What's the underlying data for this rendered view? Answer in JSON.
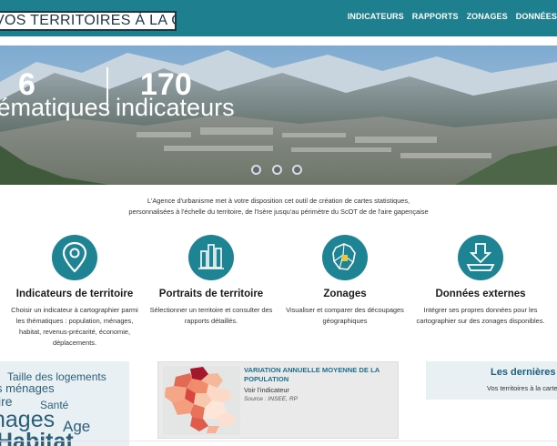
{
  "header": {
    "logo_text": "VOS TERRITOIRES À LA CARTE",
    "nav": [
      "INDICATEURS",
      "RAPPORTS",
      "ZONAGES",
      "DONNÉES"
    ]
  },
  "hero": {
    "stat1_value": "6",
    "stat1_label": "thématiques",
    "stat2_value": "170",
    "stat2_label": "indicateurs",
    "slides": 3
  },
  "intro": {
    "line1": "L'Agence d'urbanisme met à votre disposition cet outil de création de cartes statistiques,",
    "line2": "personnalisées à l'échelle du territoire, de l'Isère jusqu'au périmètre du ScOT de de l'aire gapençaise"
  },
  "features": [
    {
      "title": "Indicateurs de territoire",
      "desc": "Choisir un indicateur à cartographier parmi les thématiques : population, ménages, habitat, revenus-précarité, économie, déplacements.",
      "icon": "map-pin-icon"
    },
    {
      "title": "Portraits de territoire",
      "desc": "Sélectionner un territoire et consulter des rapports détaillés.",
      "icon": "bar-chart-icon"
    },
    {
      "title": "Zonages",
      "desc": "Visualiser et comparer des découpages géographiques",
      "icon": "map-zones-icon"
    },
    {
      "title": "Données externes",
      "desc": "Intégrer ses propres données pour les cartographier sur des zonages disponibles.",
      "icon": "upload-data-icon"
    }
  ],
  "cloud_words": [
    {
      "text": "Taille des logements"
    },
    {
      "text": "s ménages"
    },
    {
      "text": "ire"
    },
    {
      "text": "Santé"
    },
    {
      "text": "nages"
    },
    {
      "text": "Age"
    },
    {
      "text": "Habitat"
    }
  ],
  "indicator_card": {
    "title": "VARIATION ANNUELLE MOYENNE DE LA POPULATION",
    "link": "Voir l'indicateur",
    "source": "Source : INSEE, RP"
  },
  "latest_card": {
    "title": "Les dernières",
    "subtitle": "Vos territoires à la carte,"
  },
  "colors": {
    "header": "#1e7f8e",
    "accent": "#1e8494",
    "card_title": "#1e6f8e"
  }
}
